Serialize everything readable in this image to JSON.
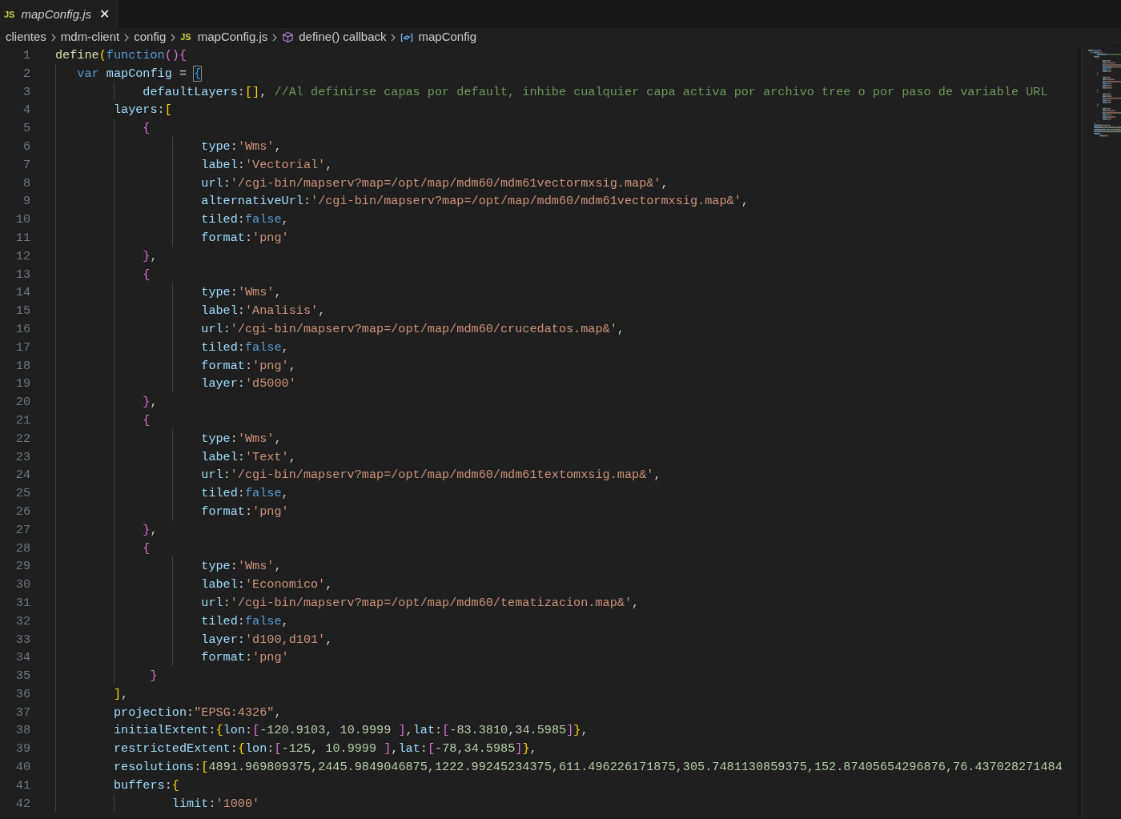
{
  "tab": {
    "label": "mapConfig.js",
    "icon": "JS",
    "preview": true,
    "selected": true,
    "close": "✕"
  },
  "breadcrumbs": [
    {
      "kind": "folder",
      "label": "clientes"
    },
    {
      "kind": "folder",
      "label": "mdm-client"
    },
    {
      "kind": "folder",
      "label": "config"
    },
    {
      "kind": "js",
      "icon": "JS",
      "label": "mapConfig.js"
    },
    {
      "kind": "callback",
      "label": "define() callback"
    },
    {
      "kind": "variable",
      "label": "mapConfig"
    }
  ],
  "lines": [
    {
      "number": "1",
      "tokens": [
        {
          "text": "define",
          "kind": "fn"
        },
        {
          "text": "(",
          "kind": "b1"
        },
        {
          "text": "function",
          "kind": "kw"
        },
        {
          "text": "()",
          "kind": "b2"
        },
        {
          "text": "{",
          "kind": "b2"
        }
      ]
    },
    {
      "number": "2",
      "tokens": [
        {
          "text": "   var",
          "kind": "kw"
        },
        {
          "text": " mapConfig",
          "kind": "key"
        },
        {
          "text": " = ",
          "kind": "p"
        },
        {
          "text": "{",
          "kind": "b3box"
        }
      ]
    },
    {
      "number": "3",
      "tokens": [
        {
          "text": "            defaultLayers",
          "kind": "key"
        },
        {
          "text": ":",
          "kind": "p"
        },
        {
          "text": "[]",
          "kind": "b1"
        },
        {
          "text": ", ",
          "kind": "p"
        },
        {
          "text": "//Al definirse capas por default, inhibe cualquier capa activa por archivo tree o por paso de variable URL",
          "kind": "cm"
        }
      ]
    },
    {
      "number": "4",
      "tokens": [
        {
          "text": "        layers",
          "kind": "key"
        },
        {
          "text": ":",
          "kind": "p"
        },
        {
          "text": "[",
          "kind": "b1"
        }
      ]
    },
    {
      "number": "5",
      "tokens": [
        {
          "text": "            {",
          "kind": "b2"
        }
      ]
    },
    {
      "number": "6",
      "tokens": [
        {
          "text": "                    type",
          "kind": "key"
        },
        {
          "text": ":",
          "kind": "p"
        },
        {
          "text": "'Wms'",
          "kind": "str"
        },
        {
          "text": ",",
          "kind": "p"
        }
      ]
    },
    {
      "number": "7",
      "tokens": [
        {
          "text": "                    label",
          "kind": "key"
        },
        {
          "text": ":",
          "kind": "p"
        },
        {
          "text": "'Vectorial'",
          "kind": "str"
        },
        {
          "text": ",",
          "kind": "p"
        }
      ]
    },
    {
      "number": "8",
      "tokens": [
        {
          "text": "                    url",
          "kind": "key"
        },
        {
          "text": ":",
          "kind": "p"
        },
        {
          "text": "'/cgi-bin/mapserv?map=/opt/map/mdm60/mdm61vectormxsig.map&'",
          "kind": "str"
        },
        {
          "text": ",",
          "kind": "p"
        }
      ]
    },
    {
      "number": "9",
      "tokens": [
        {
          "text": "                    alternativeUrl",
          "kind": "key"
        },
        {
          "text": ":",
          "kind": "p"
        },
        {
          "text": "'/cgi-bin/mapserv?map=/opt/map/mdm60/mdm61vectormxsig.map&'",
          "kind": "str"
        },
        {
          "text": ",",
          "kind": "p"
        }
      ]
    },
    {
      "number": "10",
      "tokens": [
        {
          "text": "                    tiled",
          "kind": "key"
        },
        {
          "text": ":",
          "kind": "p"
        },
        {
          "text": "false",
          "kind": "kw"
        },
        {
          "text": ",",
          "kind": "p"
        }
      ]
    },
    {
      "number": "11",
      "tokens": [
        {
          "text": "                    format",
          "kind": "key"
        },
        {
          "text": ":",
          "kind": "p"
        },
        {
          "text": "'png'",
          "kind": "str"
        }
      ]
    },
    {
      "number": "12",
      "tokens": [
        {
          "text": "            }",
          "kind": "b2"
        },
        {
          "text": ",",
          "kind": "p"
        }
      ]
    },
    {
      "number": "13",
      "tokens": [
        {
          "text": "            {",
          "kind": "b2"
        }
      ]
    },
    {
      "number": "14",
      "tokens": [
        {
          "text": "                    type",
          "kind": "key"
        },
        {
          "text": ":",
          "kind": "p"
        },
        {
          "text": "'Wms'",
          "kind": "str"
        },
        {
          "text": ",",
          "kind": "p"
        }
      ]
    },
    {
      "number": "15",
      "tokens": [
        {
          "text": "                    label",
          "kind": "key"
        },
        {
          "text": ":",
          "kind": "p"
        },
        {
          "text": "'Analisis'",
          "kind": "str"
        },
        {
          "text": ",",
          "kind": "p"
        }
      ]
    },
    {
      "number": "16",
      "tokens": [
        {
          "text": "                    url",
          "kind": "key"
        },
        {
          "text": ":",
          "kind": "p"
        },
        {
          "text": "'/cgi-bin/mapserv?map=/opt/map/mdm60/crucedatos.map&'",
          "kind": "str"
        },
        {
          "text": ",",
          "kind": "p"
        }
      ]
    },
    {
      "number": "17",
      "tokens": [
        {
          "text": "                    tiled",
          "kind": "key"
        },
        {
          "text": ":",
          "kind": "p"
        },
        {
          "text": "false",
          "kind": "kw"
        },
        {
          "text": ",",
          "kind": "p"
        }
      ]
    },
    {
      "number": "18",
      "tokens": [
        {
          "text": "                    format",
          "kind": "key"
        },
        {
          "text": ":",
          "kind": "p"
        },
        {
          "text": "'png'",
          "kind": "str"
        },
        {
          "text": ",",
          "kind": "p"
        }
      ]
    },
    {
      "number": "19",
      "tokens": [
        {
          "text": "                    layer",
          "kind": "key"
        },
        {
          "text": ":",
          "kind": "p"
        },
        {
          "text": "'d5000'",
          "kind": "str"
        }
      ]
    },
    {
      "number": "20",
      "tokens": [
        {
          "text": "            }",
          "kind": "b2"
        },
        {
          "text": ",",
          "kind": "p"
        }
      ]
    },
    {
      "number": "21",
      "tokens": [
        {
          "text": "            {",
          "kind": "b2"
        }
      ]
    },
    {
      "number": "22",
      "tokens": [
        {
          "text": "                    type",
          "kind": "key"
        },
        {
          "text": ":",
          "kind": "p"
        },
        {
          "text": "'Wms'",
          "kind": "str"
        },
        {
          "text": ",",
          "kind": "p"
        }
      ]
    },
    {
      "number": "23",
      "tokens": [
        {
          "text": "                    label",
          "kind": "key"
        },
        {
          "text": ":",
          "kind": "p"
        },
        {
          "text": "'Text'",
          "kind": "str"
        },
        {
          "text": ",",
          "kind": "p"
        }
      ]
    },
    {
      "number": "24",
      "tokens": [
        {
          "text": "                    url",
          "kind": "key"
        },
        {
          "text": ":",
          "kind": "p"
        },
        {
          "text": "'/cgi-bin/mapserv?map=/opt/map/mdm60/mdm61textomxsig.map&'",
          "kind": "str"
        },
        {
          "text": ",",
          "kind": "p"
        }
      ]
    },
    {
      "number": "25",
      "tokens": [
        {
          "text": "                    tiled",
          "kind": "key"
        },
        {
          "text": ":",
          "kind": "p"
        },
        {
          "text": "false",
          "kind": "kw"
        },
        {
          "text": ",",
          "kind": "p"
        }
      ]
    },
    {
      "number": "26",
      "tokens": [
        {
          "text": "                    format",
          "kind": "key"
        },
        {
          "text": ":",
          "kind": "p"
        },
        {
          "text": "'png'",
          "kind": "str"
        }
      ]
    },
    {
      "number": "27",
      "tokens": [
        {
          "text": "            }",
          "kind": "b2"
        },
        {
          "text": ",",
          "kind": "p"
        }
      ]
    },
    {
      "number": "28",
      "tokens": [
        {
          "text": "            {",
          "kind": "b2"
        }
      ]
    },
    {
      "number": "29",
      "tokens": [
        {
          "text": "                    type",
          "kind": "key"
        },
        {
          "text": ":",
          "kind": "p"
        },
        {
          "text": "'Wms'",
          "kind": "str"
        },
        {
          "text": ",",
          "kind": "p"
        }
      ]
    },
    {
      "number": "30",
      "tokens": [
        {
          "text": "                    label",
          "kind": "key"
        },
        {
          "text": ":",
          "kind": "p"
        },
        {
          "text": "'Economico'",
          "kind": "str"
        },
        {
          "text": ",",
          "kind": "p"
        }
      ]
    },
    {
      "number": "31",
      "tokens": [
        {
          "text": "                    url",
          "kind": "key"
        },
        {
          "text": ":",
          "kind": "p"
        },
        {
          "text": "'/cgi-bin/mapserv?map=/opt/map/mdm60/tematizacion.map&'",
          "kind": "str"
        },
        {
          "text": ",",
          "kind": "p"
        }
      ]
    },
    {
      "number": "32",
      "tokens": [
        {
          "text": "                    tiled",
          "kind": "key"
        },
        {
          "text": ":",
          "kind": "p"
        },
        {
          "text": "false",
          "kind": "kw"
        },
        {
          "text": ",",
          "kind": "p"
        }
      ]
    },
    {
      "number": "33",
      "tokens": [
        {
          "text": "                    layer",
          "kind": "key"
        },
        {
          "text": ":",
          "kind": "p"
        },
        {
          "text": "'d100,d101'",
          "kind": "str"
        },
        {
          "text": ",",
          "kind": "p"
        }
      ]
    },
    {
      "number": "34",
      "tokens": [
        {
          "text": "                    format",
          "kind": "key"
        },
        {
          "text": ":",
          "kind": "p"
        },
        {
          "text": "'png'",
          "kind": "str"
        }
      ]
    },
    {
      "number": "35",
      "tokens": [
        {
          "text": "             }",
          "kind": "b2"
        }
      ]
    },
    {
      "number": "36",
      "tokens": [
        {
          "text": "        ]",
          "kind": "b1"
        },
        {
          "text": ",",
          "kind": "p"
        }
      ]
    },
    {
      "number": "37",
      "tokens": [
        {
          "text": "        projection",
          "kind": "key"
        },
        {
          "text": ":",
          "kind": "p"
        },
        {
          "text": "\"EPSG:4326\"",
          "kind": "str"
        },
        {
          "text": ",",
          "kind": "p"
        }
      ]
    },
    {
      "number": "38",
      "tokens": [
        {
          "text": "        initialExtent",
          "kind": "key"
        },
        {
          "text": ":",
          "kind": "p"
        },
        {
          "text": "{",
          "kind": "b1"
        },
        {
          "text": "lon",
          "kind": "key"
        },
        {
          "text": ":",
          "kind": "p"
        },
        {
          "text": "[",
          "kind": "b2"
        },
        {
          "text": "-120.9103",
          "kind": "num"
        },
        {
          "text": ", ",
          "kind": "p"
        },
        {
          "text": "10.9999 ",
          "kind": "num"
        },
        {
          "text": "]",
          "kind": "b2"
        },
        {
          "text": ",",
          "kind": "p"
        },
        {
          "text": "lat",
          "kind": "key"
        },
        {
          "text": ":",
          "kind": "p"
        },
        {
          "text": "[",
          "kind": "b2"
        },
        {
          "text": "-83.3810",
          "kind": "num"
        },
        {
          "text": ",",
          "kind": "p"
        },
        {
          "text": "34.5985",
          "kind": "num"
        },
        {
          "text": "]",
          "kind": "b2"
        },
        {
          "text": "}",
          "kind": "b1"
        },
        {
          "text": ",",
          "kind": "p"
        }
      ]
    },
    {
      "number": "39",
      "tokens": [
        {
          "text": "        restrictedExtent",
          "kind": "key"
        },
        {
          "text": ":",
          "kind": "p"
        },
        {
          "text": "{",
          "kind": "b1"
        },
        {
          "text": "lon",
          "kind": "key"
        },
        {
          "text": ":",
          "kind": "p"
        },
        {
          "text": "[",
          "kind": "b2"
        },
        {
          "text": "-125",
          "kind": "num"
        },
        {
          "text": ", ",
          "kind": "p"
        },
        {
          "text": "10.9999 ",
          "kind": "num"
        },
        {
          "text": "]",
          "kind": "b2"
        },
        {
          "text": ",",
          "kind": "p"
        },
        {
          "text": "lat",
          "kind": "key"
        },
        {
          "text": ":",
          "kind": "p"
        },
        {
          "text": "[",
          "kind": "b2"
        },
        {
          "text": "-78",
          "kind": "num"
        },
        {
          "text": ",",
          "kind": "p"
        },
        {
          "text": "34.5985",
          "kind": "num"
        },
        {
          "text": "]",
          "kind": "b2"
        },
        {
          "text": "}",
          "kind": "b1"
        },
        {
          "text": ",",
          "kind": "p"
        }
      ]
    },
    {
      "number": "40",
      "tokens": [
        {
          "text": "        resolutions",
          "kind": "key"
        },
        {
          "text": ":",
          "kind": "p"
        },
        {
          "text": "[",
          "kind": "b1"
        },
        {
          "text": "4891.969809375,2445.9849046875,1222.99245234375,611.496226171875,305.7481130859375,152.87405654296876,76.437028271484",
          "kind": "num"
        }
      ]
    },
    {
      "number": "41",
      "tokens": [
        {
          "text": "        buffers",
          "kind": "key"
        },
        {
          "text": ":",
          "kind": "p"
        },
        {
          "text": "{",
          "kind": "b1"
        }
      ]
    },
    {
      "number": "42",
      "tokens": [
        {
          "text": "                limit",
          "kind": "key"
        },
        {
          "text": ":",
          "kind": "p"
        },
        {
          "text": "'1000'",
          "kind": "str"
        }
      ]
    }
  ]
}
